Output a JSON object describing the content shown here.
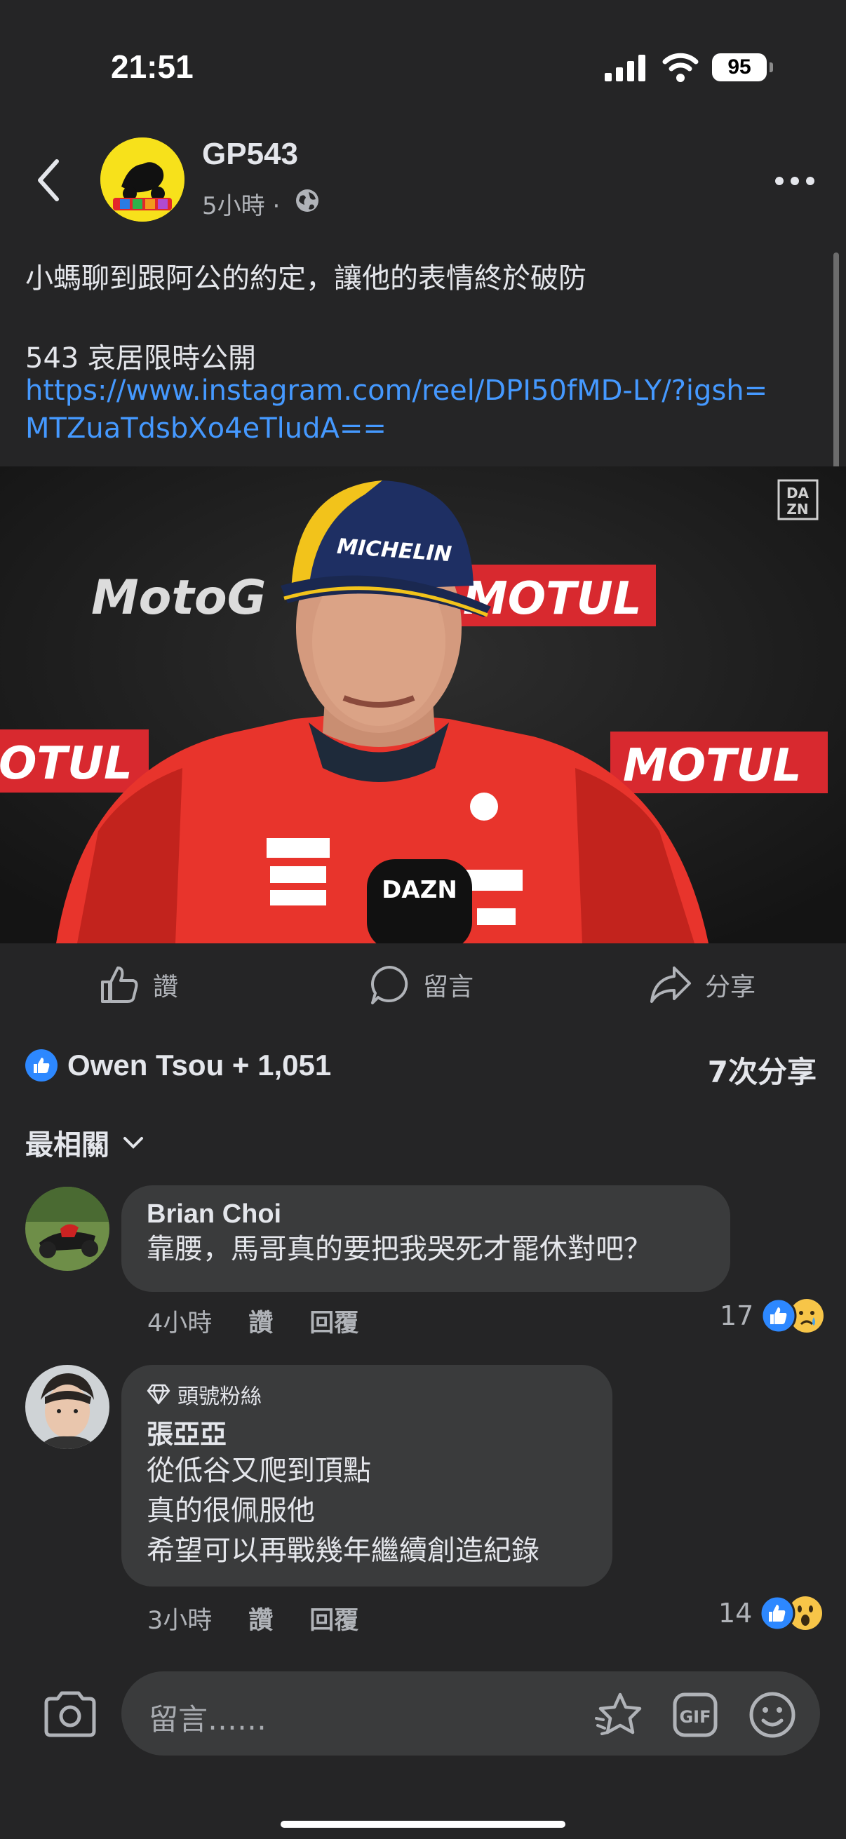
{
  "status_bar": {
    "time": "21:51",
    "battery": "95"
  },
  "header": {
    "page_name": "GP543",
    "post_time": "5小時 ·"
  },
  "post": {
    "text": "小螞聊到跟阿公的約定，讓他的表情終於破防",
    "subtext": "543 哀居限時公開",
    "link": "https://www.instagram.com/reel/DPI50fMD-LY/?igsh=MTZuaTdsbXo4eTludA=="
  },
  "video": {
    "sponsor_banner_left": "MotoG",
    "sponsor_banner_right": "MOTUL",
    "sponsor_banner_lower_left": "OTUL",
    "sponsor_banner_lower_right": "MOTUL",
    "watermark": "DAZN",
    "cap_text": "MICHELIN",
    "mic_text": "DAZN"
  },
  "actions": {
    "like": "讚",
    "comment": "留言",
    "share": "分享"
  },
  "reactions": {
    "summary": "Owen Tsou + 1,051",
    "shares": "7次分享"
  },
  "sort": {
    "label": "最相關"
  },
  "comments": [
    {
      "name": "Brian Choi",
      "text": "靠腰，馬哥真的要把我哭死才罷休對吧？",
      "time": "4小時",
      "like": "讚",
      "reply": "回覆",
      "reaction_count": "17"
    },
    {
      "badge": "頭號粉絲",
      "name": "張亞亞",
      "lines": [
        "從低谷又爬到頂點",
        "真的很佩服他",
        "希望可以再戰幾年繼續創造紀錄"
      ],
      "time": "3小時",
      "like": "讚",
      "reply": "回覆",
      "reaction_count": "14"
    }
  ],
  "composer": {
    "placeholder": "留言……"
  },
  "colors": {
    "background": "#252526",
    "bubble": "#3a3b3c",
    "link": "#4599ff",
    "like_blue": "#2d88ff",
    "jersey_red": "#e8342c"
  }
}
